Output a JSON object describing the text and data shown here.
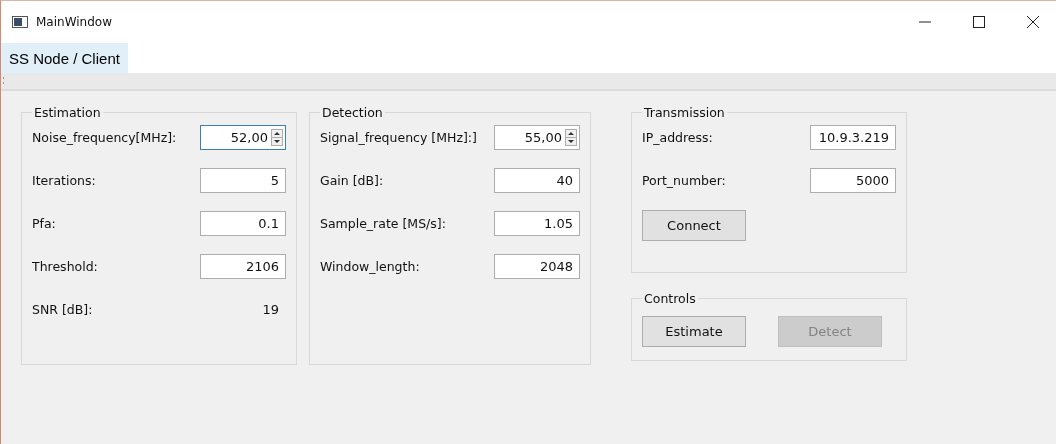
{
  "window": {
    "title": "MainWindow"
  },
  "tabs": [
    {
      "label": "SS Node / Client",
      "selected": true
    }
  ],
  "groups": [
    {
      "title": "Estimation",
      "rows": [
        {
          "label": "Noise_frequency[MHz]:",
          "kind": "spin",
          "value": "52,00",
          "focused": true
        },
        {
          "label": "Iterations:",
          "kind": "input",
          "value": "5",
          "focused": false
        },
        {
          "label": "Pfa:",
          "kind": "input",
          "value": "0.1",
          "focused": false
        },
        {
          "label": "Threshold:",
          "kind": "input",
          "value": "2106",
          "focused": false
        },
        {
          "label": "SNR [dB]:",
          "kind": "value",
          "value": "19"
        }
      ]
    },
    {
      "title": "Detection",
      "rows": [
        {
          "label": "Signal_frequency [MHz]:]",
          "kind": "spin",
          "value": "55,00",
          "focused": false
        },
        {
          "label": "Gain [dB]:",
          "kind": "input",
          "value": "40",
          "focused": false
        },
        {
          "label": "Sample_rate [MS/s]:",
          "kind": "input",
          "value": "1.05",
          "focused": false
        },
        {
          "label": "Window_length:",
          "kind": "input",
          "value": "2048",
          "focused": false
        }
      ]
    }
  ],
  "transmission": {
    "title": "Transmission",
    "rows": [
      {
        "label": "IP_address:",
        "kind": "input",
        "value": "10.9.3.219",
        "focused": false
      },
      {
        "label": "Port_number:",
        "kind": "input",
        "value": "5000",
        "focused": false
      }
    ],
    "buttons": [
      {
        "label": "Connect",
        "disabled": false
      }
    ]
  },
  "controls": {
    "title": "Controls",
    "buttons": [
      {
        "label": "Estimate",
        "disabled": false
      },
      {
        "label": "Detect",
        "disabled": true
      }
    ]
  }
}
